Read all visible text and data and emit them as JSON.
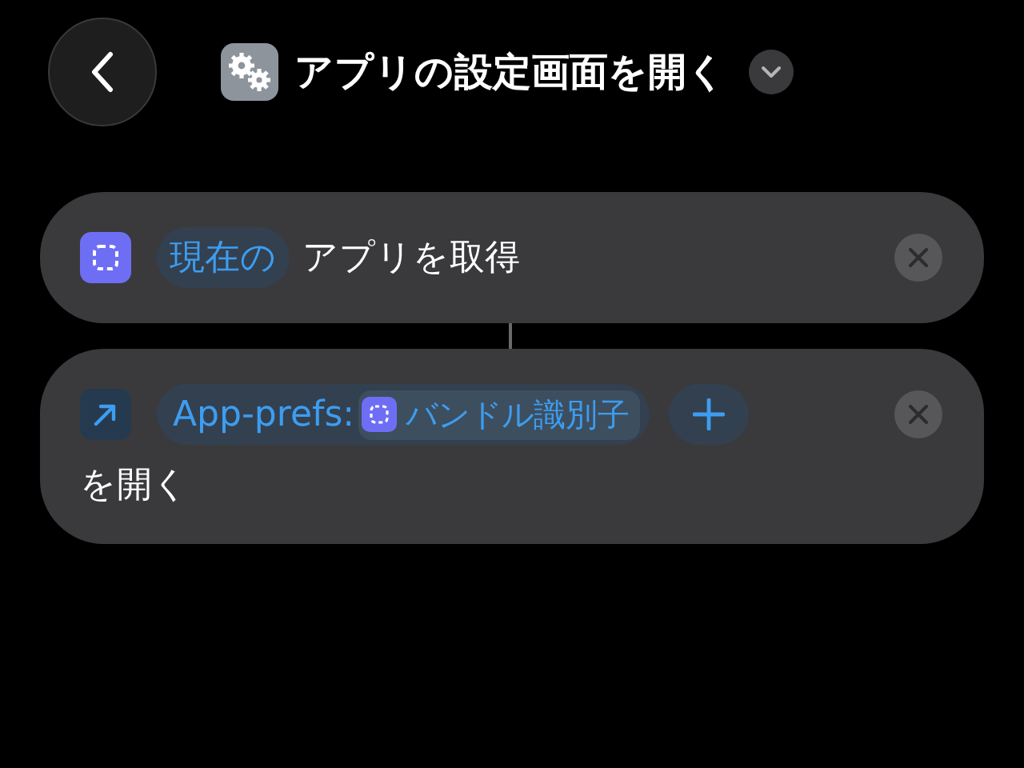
{
  "header": {
    "title": "アプリの設定画面を開く"
  },
  "actions": [
    {
      "kind": "get_app",
      "parameter": "現在の",
      "text": "アプリを取得"
    },
    {
      "kind": "open_url",
      "url_prefix": "App-prefs:",
      "variable": "バンドル識別子",
      "text": "を開く"
    }
  ]
}
